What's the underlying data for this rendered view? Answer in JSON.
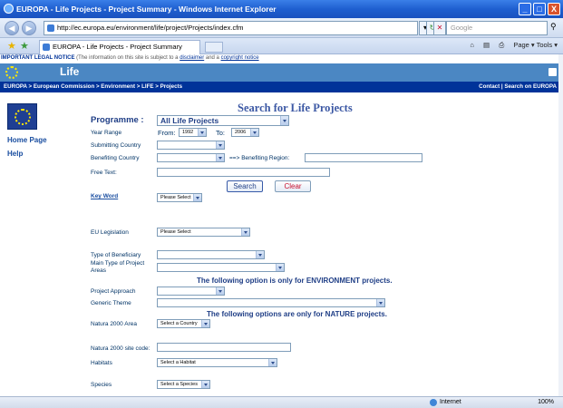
{
  "window": {
    "title": "EUROPA - Life Projects - Project Summary - Windows Internet Explorer",
    "buttons": [
      "_",
      "□",
      "X"
    ]
  },
  "addressbar": {
    "url": "http://ec.europa.eu/environment/life/project/Projects/index.cfm",
    "search_placeholder": "Google"
  },
  "tabbar": {
    "tab_title": "EUROPA - Life Projects - Project Summary",
    "commands": "Page ▾   Tools ▾"
  },
  "legal": {
    "prefix": "IMPORTANT LEGAL NOTICE",
    "text": " (The information on this site is subject to a ",
    "disclaimer": "disclaimer",
    "and": " and a ",
    "copyright": "copyright notice"
  },
  "site": {
    "title": "Life",
    "breadcrumb": "EUROPA > European Commission > Environment > LIFE > Projects",
    "top_links": "Contact | Search on EUROPA"
  },
  "sidebar": {
    "items": [
      {
        "label": "Home Page"
      },
      {
        "label": "Help"
      }
    ]
  },
  "form": {
    "heading": "Search for Life Projects",
    "programme_label": "Programme :",
    "programme_value": "All Life Projects",
    "year_range_label": "Year Range",
    "from_label": "From:",
    "from_value": "1992",
    "to_label": "To:",
    "to_value": "2006",
    "submitting_country_label": "Submitting Country",
    "benefiting_country_label": "Benefiting Country",
    "benefiting_region_label": "==> Benefiting Region:",
    "free_text_label": "Free Text:",
    "search_button": "Search",
    "clear_button": "Clear",
    "keyword_label": "Key Word",
    "keyword_value": "Please Select",
    "eu_legislation_label": "EU Legislation",
    "eu_legislation_value": "Please Select",
    "beneficiary_label": "Type of Beneficiary",
    "main_type_label_1": "Main Type of Project",
    "main_type_label_2": "Areas",
    "env_note": "The following option is only for ENVIRONMENT projects.",
    "project_approach_label": "Project Approach",
    "generic_theme_label": "Generic Theme",
    "nature_note": "The following options are only for NATURE projects.",
    "natura_area_label": "Natura 2000 Area",
    "natura_area_value": "Select a Country",
    "natura_site_label": "Natura 2000 site code:",
    "habitats_label": "Habitats",
    "habitats_value": "Select a Habitat",
    "species_label": "Species",
    "species_value": "Select a Species"
  },
  "status": {
    "zone": "Internet",
    "zoom": "100%"
  }
}
